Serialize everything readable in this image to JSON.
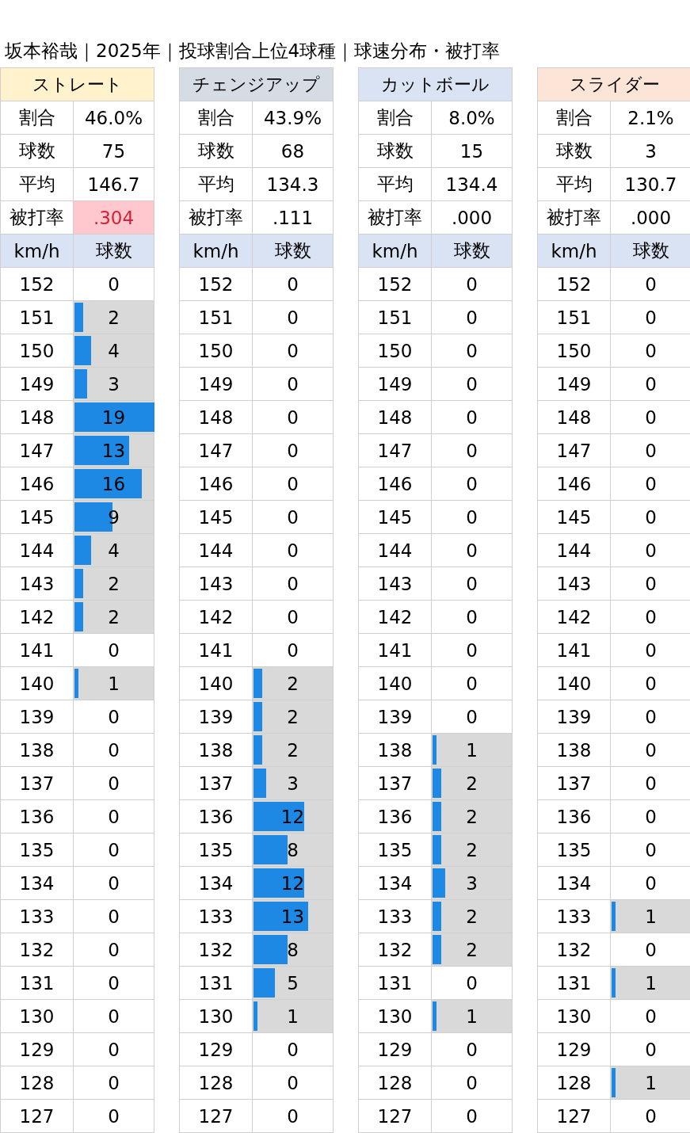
{
  "title": "坂本裕哉｜2025年｜投球割合上位4球種｜球速分布・被打率",
  "pitches": [
    {
      "name": "ストレート",
      "color": "#fff2cc",
      "stats": [
        {
          "label": "割合",
          "value": "46.0%",
          "highlight": false
        },
        {
          "label": "球数",
          "value": "75",
          "highlight": false
        },
        {
          "label": "平均",
          "value": "146.7",
          "highlight": false
        },
        {
          "label": "被打率",
          "value": ".304",
          "highlight": true
        }
      ],
      "columns": [
        "km/h",
        "球数"
      ],
      "rows": [
        {
          "speed": "152",
          "count": "0"
        },
        {
          "speed": "151",
          "count": "2",
          "level": 0.105
        },
        {
          "speed": "150",
          "count": "4",
          "level": 0.211
        },
        {
          "speed": "149",
          "count": "3",
          "level": 0.158
        },
        {
          "speed": "148",
          "count": "19",
          "level": 1
        },
        {
          "speed": "147",
          "count": "13",
          "level": 0.684
        },
        {
          "speed": "146",
          "count": "16",
          "level": 0.842
        },
        {
          "speed": "145",
          "count": "9",
          "level": 0.474
        },
        {
          "speed": "144",
          "count": "4",
          "level": 0.211
        },
        {
          "speed": "143",
          "count": "2",
          "level": 0.105
        },
        {
          "speed": "142",
          "count": "2",
          "level": 0.105
        },
        {
          "speed": "141",
          "count": "0"
        },
        {
          "speed": "140",
          "count": "1",
          "level": 0.053
        },
        {
          "speed": "139",
          "count": "0"
        },
        {
          "speed": "138",
          "count": "0"
        },
        {
          "speed": "137",
          "count": "0"
        },
        {
          "speed": "136",
          "count": "0"
        },
        {
          "speed": "135",
          "count": "0"
        },
        {
          "speed": "134",
          "count": "0"
        },
        {
          "speed": "133",
          "count": "0"
        },
        {
          "speed": "132",
          "count": "0"
        },
        {
          "speed": "131",
          "count": "0"
        },
        {
          "speed": "130",
          "count": "0"
        },
        {
          "speed": "129",
          "count": "0"
        },
        {
          "speed": "128",
          "count": "0"
        },
        {
          "speed": "127",
          "count": "0"
        }
      ]
    },
    {
      "name": "チェンジアップ",
      "color": "#d6dce4",
      "stats": [
        {
          "label": "割合",
          "value": "43.9%",
          "highlight": false
        },
        {
          "label": "球数",
          "value": "68",
          "highlight": false
        },
        {
          "label": "平均",
          "value": "134.3",
          "highlight": false
        },
        {
          "label": "被打率",
          "value": ".111",
          "highlight": false
        }
      ],
      "columns": [
        "km/h",
        "球数"
      ],
      "rows": [
        {
          "speed": "152",
          "count": "0"
        },
        {
          "speed": "151",
          "count": "0"
        },
        {
          "speed": "150",
          "count": "0"
        },
        {
          "speed": "149",
          "count": "0"
        },
        {
          "speed": "148",
          "count": "0"
        },
        {
          "speed": "147",
          "count": "0"
        },
        {
          "speed": "146",
          "count": "0"
        },
        {
          "speed": "145",
          "count": "0"
        },
        {
          "speed": "144",
          "count": "0"
        },
        {
          "speed": "143",
          "count": "0"
        },
        {
          "speed": "142",
          "count": "0"
        },
        {
          "speed": "141",
          "count": "0"
        },
        {
          "speed": "140",
          "count": "2",
          "level": 0.105
        },
        {
          "speed": "139",
          "count": "2",
          "level": 0.105
        },
        {
          "speed": "138",
          "count": "2",
          "level": 0.105
        },
        {
          "speed": "137",
          "count": "3",
          "level": 0.158
        },
        {
          "speed": "136",
          "count": "12",
          "level": 0.632
        },
        {
          "speed": "135",
          "count": "8",
          "level": 0.421
        },
        {
          "speed": "134",
          "count": "12",
          "level": 0.632
        },
        {
          "speed": "133",
          "count": "13",
          "level": 0.684
        },
        {
          "speed": "132",
          "count": "8",
          "level": 0.421
        },
        {
          "speed": "131",
          "count": "5",
          "level": 0.263
        },
        {
          "speed": "130",
          "count": "1",
          "level": 0.053
        },
        {
          "speed": "129",
          "count": "0"
        },
        {
          "speed": "128",
          "count": "0"
        },
        {
          "speed": "127",
          "count": "0"
        }
      ]
    },
    {
      "name": "カットボール",
      "color": "#dae3f3",
      "stats": [
        {
          "label": "割合",
          "value": "8.0%",
          "highlight": false
        },
        {
          "label": "球数",
          "value": "15",
          "highlight": false
        },
        {
          "label": "平均",
          "value": "134.4",
          "highlight": false
        },
        {
          "label": "被打率",
          "value": ".000",
          "highlight": false
        }
      ],
      "columns": [
        "km/h",
        "球数"
      ],
      "rows": [
        {
          "speed": "152",
          "count": "0"
        },
        {
          "speed": "151",
          "count": "0"
        },
        {
          "speed": "150",
          "count": "0"
        },
        {
          "speed": "149",
          "count": "0"
        },
        {
          "speed": "148",
          "count": "0"
        },
        {
          "speed": "147",
          "count": "0"
        },
        {
          "speed": "146",
          "count": "0"
        },
        {
          "speed": "145",
          "count": "0"
        },
        {
          "speed": "144",
          "count": "0"
        },
        {
          "speed": "143",
          "count": "0"
        },
        {
          "speed": "142",
          "count": "0"
        },
        {
          "speed": "141",
          "count": "0"
        },
        {
          "speed": "140",
          "count": "0"
        },
        {
          "speed": "139",
          "count": "0"
        },
        {
          "speed": "138",
          "count": "1",
          "level": 0.053
        },
        {
          "speed": "137",
          "count": "2",
          "level": 0.105
        },
        {
          "speed": "136",
          "count": "2",
          "level": 0.105
        },
        {
          "speed": "135",
          "count": "2",
          "level": 0.105
        },
        {
          "speed": "134",
          "count": "3",
          "level": 0.158
        },
        {
          "speed": "133",
          "count": "2",
          "level": 0.105
        },
        {
          "speed": "132",
          "count": "2",
          "level": 0.105
        },
        {
          "speed": "131",
          "count": "0"
        },
        {
          "speed": "130",
          "count": "1",
          "level": 0.053
        },
        {
          "speed": "129",
          "count": "0"
        },
        {
          "speed": "128",
          "count": "0"
        },
        {
          "speed": "127",
          "count": "0"
        }
      ]
    },
    {
      "name": "スライダー",
      "color": "#fce4d6",
      "stats": [
        {
          "label": "割合",
          "value": "2.1%",
          "highlight": false
        },
        {
          "label": "球数",
          "value": "3",
          "highlight": false
        },
        {
          "label": "平均",
          "value": "130.7",
          "highlight": false
        },
        {
          "label": "被打率",
          "value": ".000",
          "highlight": false
        }
      ],
      "columns": [
        "km/h",
        "球数"
      ],
      "rows": [
        {
          "speed": "152",
          "count": "0"
        },
        {
          "speed": "151",
          "count": "0"
        },
        {
          "speed": "150",
          "count": "0"
        },
        {
          "speed": "149",
          "count": "0"
        },
        {
          "speed": "148",
          "count": "0"
        },
        {
          "speed": "147",
          "count": "0"
        },
        {
          "speed": "146",
          "count": "0"
        },
        {
          "speed": "145",
          "count": "0"
        },
        {
          "speed": "144",
          "count": "0"
        },
        {
          "speed": "143",
          "count": "0"
        },
        {
          "speed": "142",
          "count": "0"
        },
        {
          "speed": "141",
          "count": "0"
        },
        {
          "speed": "140",
          "count": "0"
        },
        {
          "speed": "139",
          "count": "0"
        },
        {
          "speed": "138",
          "count": "0"
        },
        {
          "speed": "137",
          "count": "0"
        },
        {
          "speed": "136",
          "count": "0"
        },
        {
          "speed": "135",
          "count": "0"
        },
        {
          "speed": "134",
          "count": "0"
        },
        {
          "speed": "133",
          "count": "1",
          "level": 0.053
        },
        {
          "speed": "132",
          "count": "0"
        },
        {
          "speed": "131",
          "count": "1",
          "level": 0.053
        },
        {
          "speed": "130",
          "count": "0"
        },
        {
          "speed": "129",
          "count": "0"
        },
        {
          "speed": "128",
          "count": "1",
          "level": 0.053
        },
        {
          "speed": "127",
          "count": "0"
        }
      ]
    }
  ]
}
